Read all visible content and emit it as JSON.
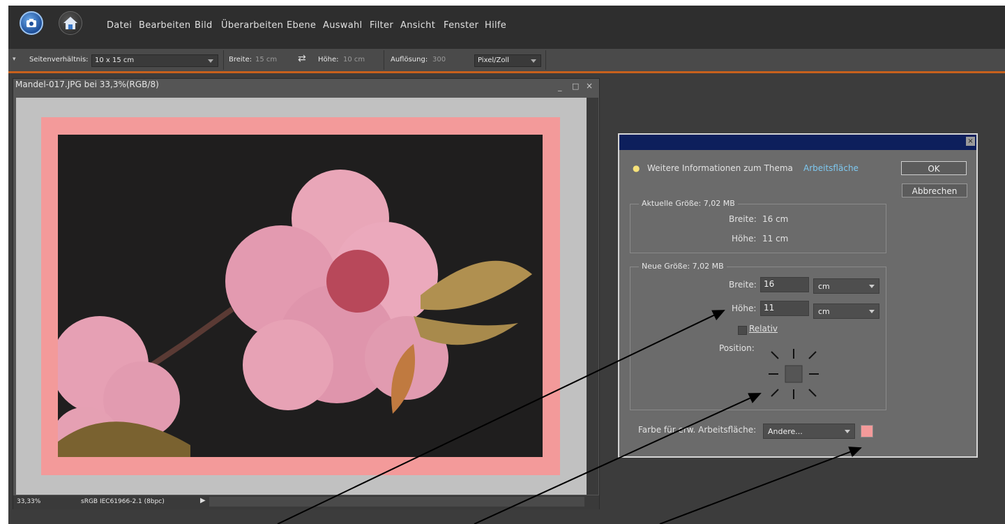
{
  "menu": [
    "Datei",
    "Bearbeiten",
    "Bild",
    "Überarbeiten",
    "Ebene",
    "Auswahl",
    "Filter",
    "Ansicht",
    "Fenster",
    "Hilfe"
  ],
  "options": {
    "aspect_label": "Seitenverhältnis:",
    "aspect_value": "10 x 15 cm",
    "width_label": "Breite:",
    "width_value": "15 cm",
    "height_label": "Höhe:",
    "height_value": "10 cm",
    "resolution_label": "Auflösung:",
    "resolution_value": "300",
    "unit_value": "Pixel/Zoll"
  },
  "document": {
    "title": "Mandel-017.JPG bei 33,3%(RGB/8)",
    "zoom": "33,33%",
    "profile": "sRGB IEC61966-2.1 (8bpc)",
    "controls": [
      "_",
      "□",
      "×"
    ]
  },
  "dialog": {
    "info_text": "Weitere Informationen zum Thema",
    "info_link": "Arbeitsfläche",
    "ok": "OK",
    "cancel": "Abbrechen",
    "current_group": "Aktuelle Größe: 7,02 MB",
    "current_width_label": "Breite:",
    "current_width_value": "16 cm",
    "current_height_label": "Höhe:",
    "current_height_value": "11 cm",
    "new_group": "Neue Größe: 7,02 MB",
    "new_width_label": "Breite:",
    "new_width_value": "16",
    "new_height_label": "Höhe:",
    "new_height_value": "11",
    "unit_width": "cm",
    "unit_height": "cm",
    "relative_label": "Relativ",
    "position_label": "Position:",
    "extension_color_label": "Farbe für erw. Arbeitsfläche:",
    "extension_color_value": "Andere...",
    "extension_color": "#f39a9a"
  }
}
